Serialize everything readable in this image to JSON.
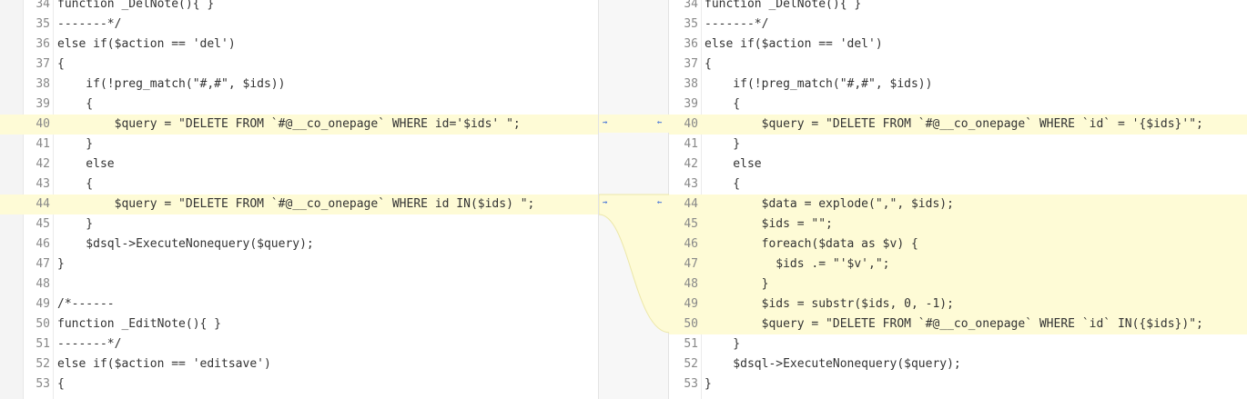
{
  "left": {
    "lines": [
      {
        "n": "34",
        "t": "function _DelNote(){ }",
        "changed": false
      },
      {
        "n": "35",
        "t": "-------*/",
        "changed": false
      },
      {
        "n": "36",
        "t": "else if($action == 'del')",
        "changed": false
      },
      {
        "n": "37",
        "t": "{",
        "changed": false
      },
      {
        "n": "38",
        "t": "    if(!preg_match(\"#,#\", $ids))",
        "changed": false
      },
      {
        "n": "39",
        "t": "    {",
        "changed": false
      },
      {
        "n": "40",
        "t": "        $query = \"DELETE FROM `#@__co_onepage` WHERE id='$ids' \";",
        "changed": true
      },
      {
        "n": "41",
        "t": "    }",
        "changed": false
      },
      {
        "n": "42",
        "t": "    else",
        "changed": false
      },
      {
        "n": "43",
        "t": "    {",
        "changed": false
      },
      {
        "n": "44",
        "t": "        $query = \"DELETE FROM `#@__co_onepage` WHERE id IN($ids) \";",
        "changed": true
      },
      {
        "n": "45",
        "t": "    }",
        "changed": false
      },
      {
        "n": "46",
        "t": "    $dsql->ExecuteNonequery($query);",
        "changed": false
      },
      {
        "n": "47",
        "t": "}",
        "changed": false
      },
      {
        "n": "48",
        "t": "",
        "changed": false
      },
      {
        "n": "49",
        "t": "/*------",
        "changed": false
      },
      {
        "n": "50",
        "t": "function _EditNote(){ }",
        "changed": false
      },
      {
        "n": "51",
        "t": "-------*/",
        "changed": false
      },
      {
        "n": "52",
        "t": "else if($action == 'editsave')",
        "changed": false
      },
      {
        "n": "53",
        "t": "{",
        "changed": false
      }
    ]
  },
  "right": {
    "lines": [
      {
        "n": "34",
        "t": "function _DelNote(){ }",
        "changed": false
      },
      {
        "n": "35",
        "t": "-------*/",
        "changed": false
      },
      {
        "n": "36",
        "t": "else if($action == 'del')",
        "changed": false
      },
      {
        "n": "37",
        "t": "{",
        "changed": false
      },
      {
        "n": "38",
        "t": "    if(!preg_match(\"#,#\", $ids))",
        "changed": false
      },
      {
        "n": "39",
        "t": "    {",
        "changed": false
      },
      {
        "n": "40",
        "t": "        $query = \"DELETE FROM `#@__co_onepage` WHERE `id` = '{$ids}'\";",
        "changed": true
      },
      {
        "n": "41",
        "t": "    }",
        "changed": false
      },
      {
        "n": "42",
        "t": "    else",
        "changed": false
      },
      {
        "n": "43",
        "t": "    {",
        "changed": false
      },
      {
        "n": "44",
        "t": "        $data = explode(\",\", $ids);",
        "changed": true
      },
      {
        "n": "45",
        "t": "        $ids = \"\";",
        "changed": true
      },
      {
        "n": "46",
        "t": "        foreach($data as $v) {",
        "changed": true
      },
      {
        "n": "47",
        "t": "          $ids .= \"'$v',\";",
        "changed": true
      },
      {
        "n": "48",
        "t": "        }",
        "changed": true
      },
      {
        "n": "49",
        "t": "        $ids = substr($ids, 0, -1);",
        "changed": true
      },
      {
        "n": "50",
        "t": "        $query = \"DELETE FROM `#@__co_onepage` WHERE `id` IN({$ids})\";",
        "changed": true
      },
      {
        "n": "51",
        "t": "    }",
        "changed": false
      },
      {
        "n": "52",
        "t": "    $dsql->ExecuteNonequery($query);",
        "changed": false
      },
      {
        "n": "53",
        "t": "}",
        "changed": false
      }
    ]
  },
  "connector": {
    "arrow_right": "⇝",
    "arrow_left": "⇜"
  },
  "colors": {
    "changed_bg": "#fefbd6",
    "arrow": "#3a6bd8",
    "squiggle_green": "#6a9e1f",
    "squiggle_red": "#c01010"
  }
}
